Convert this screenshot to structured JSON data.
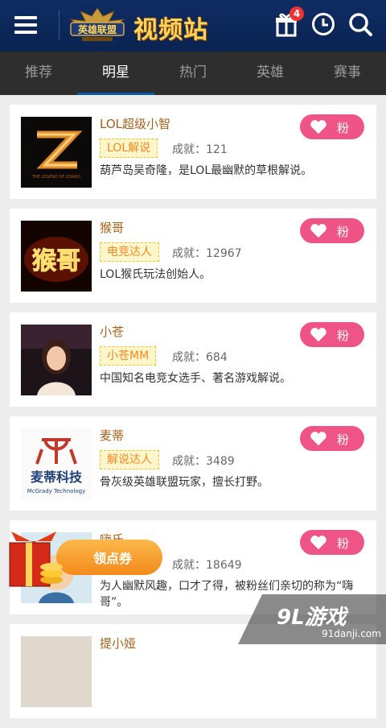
{
  "header": {
    "logo_text": "英雄联盟",
    "title": "视频站",
    "gift_badge": "4",
    "icons": [
      "menu-icon",
      "gift-icon",
      "clock-icon",
      "search-icon"
    ],
    "bg_color": "#0f2c63"
  },
  "tabs": [
    {
      "label": "推荐",
      "active": false
    },
    {
      "label": "明星",
      "active": true
    },
    {
      "label": "热门",
      "active": false
    },
    {
      "label": "英雄",
      "active": false
    },
    {
      "label": "赛事",
      "active": false
    }
  ],
  "list": {
    "score_label": "成就：",
    "fan_label": "粉",
    "items": [
      {
        "name": "LOL超级小智",
        "tag": "LOL解说",
        "score": "121",
        "desc": "葫芦岛吴奇隆，是LOL最幽默的草根解说。",
        "avatar_text": "THE LEGEND OF ZORRO"
      },
      {
        "name": "猴哥",
        "tag": "电竞达人",
        "score": "12967",
        "desc": "LOL猴氏玩法创始人。",
        "avatar_text": "猴哥"
      },
      {
        "name": "小苍",
        "tag": "小苍MM",
        "score": "684",
        "desc": "中国知名电竞女选手、著名游戏解说。",
        "avatar_text": ""
      },
      {
        "name": "麦蒂",
        "tag": "解说达人",
        "score": "3489",
        "desc": "骨灰级英雄联盟玩家，擅长打野。",
        "avatar_text": "麦蒂科技"
      },
      {
        "name": "嗨氏",
        "tag": "",
        "score": "18649",
        "desc": "为人幽默风趣，口才了得，被粉丝们亲切的称为“嗨哥”。",
        "avatar_text": ""
      },
      {
        "name": "提小娅",
        "tag": "",
        "score": "",
        "desc": "",
        "avatar_text": ""
      }
    ]
  },
  "coupon": {
    "label": "领点券"
  },
  "watermark": {
    "text": "9L游戏",
    "url": "91danji.com"
  },
  "colors": {
    "fan_button": "#ee5586",
    "tab_bar": "#2e2e2e",
    "tab_underline": "#0b5aa8",
    "name": "#a8601a",
    "tag": "#f08a1e"
  }
}
